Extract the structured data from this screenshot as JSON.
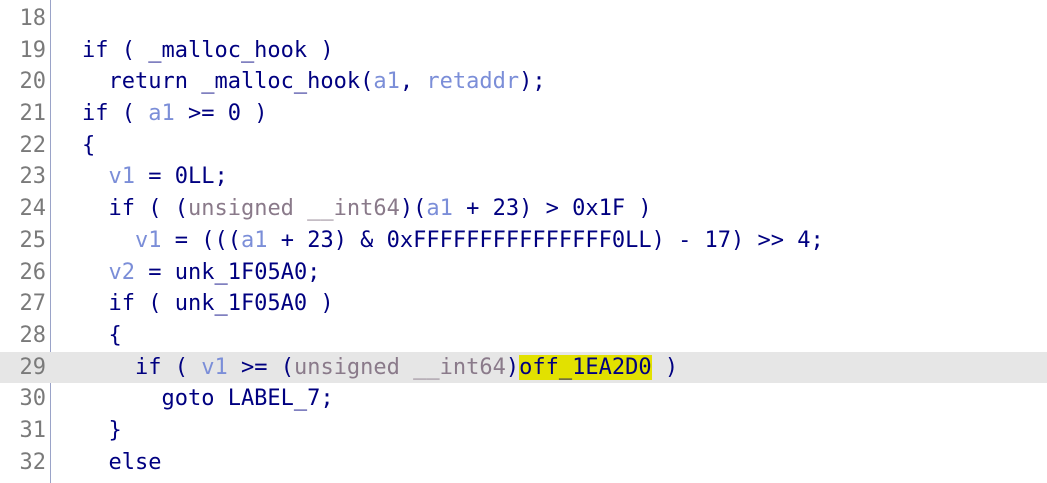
{
  "editor": {
    "current_line": "29",
    "lines": [
      {
        "num": "18",
        "tokens": []
      },
      {
        "num": "19",
        "tokens": [
          {
            "t": "if ( _malloc_hook )",
            "k": "plain"
          }
        ]
      },
      {
        "num": "20",
        "tokens": [
          {
            "t": "  return _malloc_hook(",
            "k": "plain"
          },
          {
            "t": "a1",
            "k": "var"
          },
          {
            "t": ", ",
            "k": "plain"
          },
          {
            "t": "retaddr",
            "k": "var"
          },
          {
            "t": ");",
            "k": "plain"
          }
        ]
      },
      {
        "num": "21",
        "tokens": [
          {
            "t": "if ( ",
            "k": "plain"
          },
          {
            "t": "a1",
            "k": "var"
          },
          {
            "t": " >= 0 )",
            "k": "plain"
          }
        ]
      },
      {
        "num": "22",
        "tokens": [
          {
            "t": "{",
            "k": "plain"
          }
        ]
      },
      {
        "num": "23",
        "tokens": [
          {
            "t": "  ",
            "k": "plain"
          },
          {
            "t": "v1",
            "k": "var"
          },
          {
            "t": " = 0LL;",
            "k": "plain"
          }
        ]
      },
      {
        "num": "24",
        "tokens": [
          {
            "t": "  if ( (",
            "k": "plain"
          },
          {
            "t": "unsigned __int64",
            "k": "type"
          },
          {
            "t": ")(",
            "k": "plain"
          },
          {
            "t": "a1",
            "k": "var"
          },
          {
            "t": " + 23) > 0x1F )",
            "k": "plain"
          }
        ]
      },
      {
        "num": "25",
        "tokens": [
          {
            "t": "    ",
            "k": "plain"
          },
          {
            "t": "v1",
            "k": "var"
          },
          {
            "t": " = (((",
            "k": "plain"
          },
          {
            "t": "a1",
            "k": "var"
          },
          {
            "t": " + 23) & 0xFFFFFFFFFFFFFFF0LL) - 17) >> 4;",
            "k": "plain"
          }
        ]
      },
      {
        "num": "26",
        "tokens": [
          {
            "t": "  ",
            "k": "plain"
          },
          {
            "t": "v2",
            "k": "var"
          },
          {
            "t": " = unk_1F05A0;",
            "k": "plain"
          }
        ]
      },
      {
        "num": "27",
        "tokens": [
          {
            "t": "  if ( unk_1F05A0 )",
            "k": "plain"
          }
        ]
      },
      {
        "num": "28",
        "tokens": [
          {
            "t": "  {",
            "k": "plain"
          }
        ]
      },
      {
        "num": "29",
        "tokens": [
          {
            "t": "    if ( ",
            "k": "plain"
          },
          {
            "t": "v1",
            "k": "var"
          },
          {
            "t": " >= (",
            "k": "plain"
          },
          {
            "t": "unsigned __int64",
            "k": "type"
          },
          {
            "t": ")",
            "k": "plain"
          },
          {
            "t": "off_1EA2D0",
            "k": "hl"
          },
          {
            "t": " )",
            "k": "plain"
          }
        ]
      },
      {
        "num": "30",
        "tokens": [
          {
            "t": "      goto LABEL_7;",
            "k": "plain"
          }
        ]
      },
      {
        "num": "31",
        "tokens": [
          {
            "t": "  }",
            "k": "plain"
          }
        ]
      },
      {
        "num": "32",
        "tokens": [
          {
            "t": "  else",
            "k": "plain"
          }
        ]
      }
    ]
  },
  "colors": {
    "code_default": "#000080",
    "variable": "#7b8ed8",
    "type": "#8a7a8a",
    "highlight": "#e2e100",
    "current_line_bg": "#e6e6e6",
    "line_number": "#7a7a7a"
  }
}
